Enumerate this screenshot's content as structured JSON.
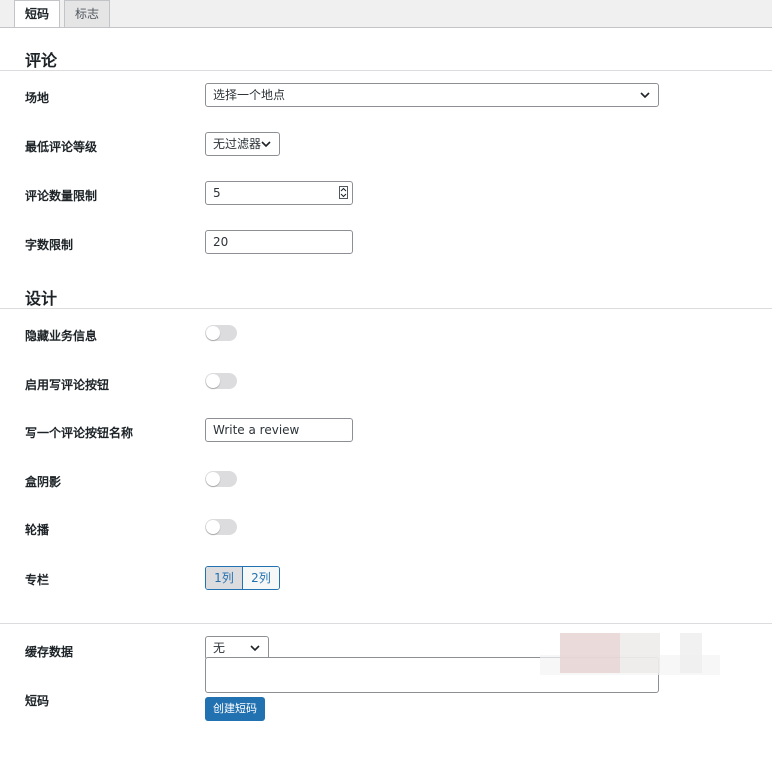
{
  "tabs": [
    {
      "label": "短码",
      "active": true
    },
    {
      "label": "标志",
      "active": false
    }
  ],
  "reviews_section": {
    "title": "评论"
  },
  "fields": {
    "venue": {
      "label": "场地",
      "value": "选择一个地点"
    },
    "min_rating": {
      "label": "最低评论等级",
      "value": "无过滤器"
    },
    "review_limit": {
      "label": "评论数量限制",
      "value": "5"
    },
    "word_limit": {
      "label": "字数限制",
      "value": "20"
    }
  },
  "design_section": {
    "title": "设计"
  },
  "design": {
    "hide_business_info": {
      "label": "隐藏业务信息",
      "on": false
    },
    "enable_write_review": {
      "label": "启用写评论按钮",
      "on": false
    },
    "write_review_button_name": {
      "label": "写一个评论按钮名称",
      "value": "Write a review"
    },
    "box_shadow": {
      "label": "盒阴影",
      "on": false
    },
    "carousel": {
      "label": "轮播",
      "on": false
    },
    "columns": {
      "label": "专栏",
      "options": [
        "1列",
        "2列"
      ],
      "selected": "1列"
    }
  },
  "cache": {
    "label": "缓存数据",
    "value": "无"
  },
  "shortcode": {
    "label": "短码",
    "value": "",
    "button_label": "创建短码"
  },
  "colors": {
    "accent": "#2271b1",
    "toggle_off": "#dcdcde",
    "border": "#8c8f94"
  }
}
